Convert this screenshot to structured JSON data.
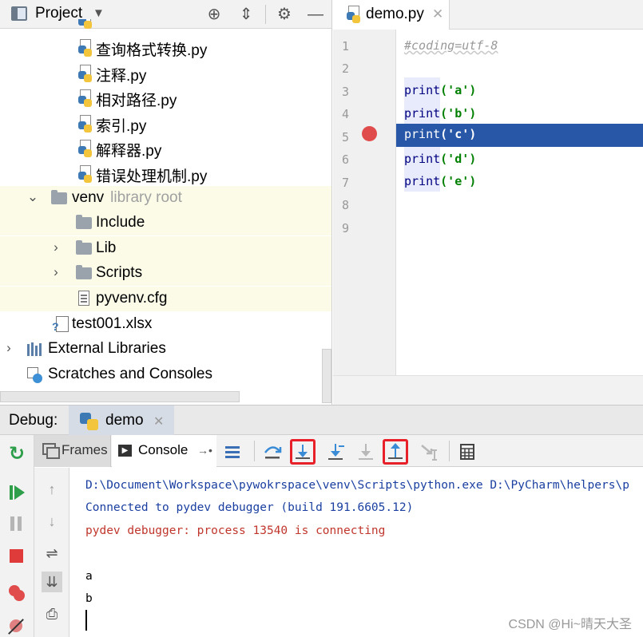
{
  "project": {
    "title": "Project",
    "items": [
      {
        "label": "查询格式转换.py"
      },
      {
        "label": "注释.py"
      },
      {
        "label": "相对路径.py"
      },
      {
        "label": "索引.py"
      },
      {
        "label": "解释器.py"
      },
      {
        "label": "错误处理机制.py"
      },
      {
        "label": "venv",
        "sub": "library root"
      },
      {
        "label": "Include"
      },
      {
        "label": "Lib"
      },
      {
        "label": "Scripts"
      },
      {
        "label": "pyvenv.cfg"
      },
      {
        "label": "test001.xlsx"
      },
      {
        "label": "External Libraries"
      },
      {
        "label": "Scratches and Consoles"
      }
    ]
  },
  "editor": {
    "tab": "demo.py",
    "lines": [
      {
        "n": "1",
        "text": "#coding=utf-8"
      },
      {
        "n": "2",
        "text": ""
      },
      {
        "n": "3",
        "fn": "print",
        "arg": "('a')"
      },
      {
        "n": "4",
        "fn": "print",
        "arg": "('b')"
      },
      {
        "n": "5",
        "fn": "print",
        "arg": "('c')"
      },
      {
        "n": "6",
        "fn": "print",
        "arg": "('d')"
      },
      {
        "n": "7",
        "fn": "print",
        "arg": "('e')"
      },
      {
        "n": "8",
        "text": ""
      },
      {
        "n": "9",
        "text": ""
      }
    ]
  },
  "debug": {
    "label": "Debug:",
    "tab": "demo",
    "frames_tab": "Frames",
    "console_tab": "Console",
    "console": {
      "cmd": "D:\\Document\\Workspace\\pywokrspace\\venv\\Scripts\\python.exe D:\\PyCharm\\helpers\\p",
      "connected": "Connected to pydev debugger (build 191.6605.12)",
      "process": "pydev debugger: process 13540 is connecting",
      "out1": "a",
      "out2": "b"
    }
  },
  "watermark": "CSDN @Hi~晴天大圣",
  "colors": {
    "current_line": "#2857a8",
    "breakpoint": "#e04b4b",
    "highlight_box": "#e8202a",
    "library_bg": "#fbfbe8"
  }
}
